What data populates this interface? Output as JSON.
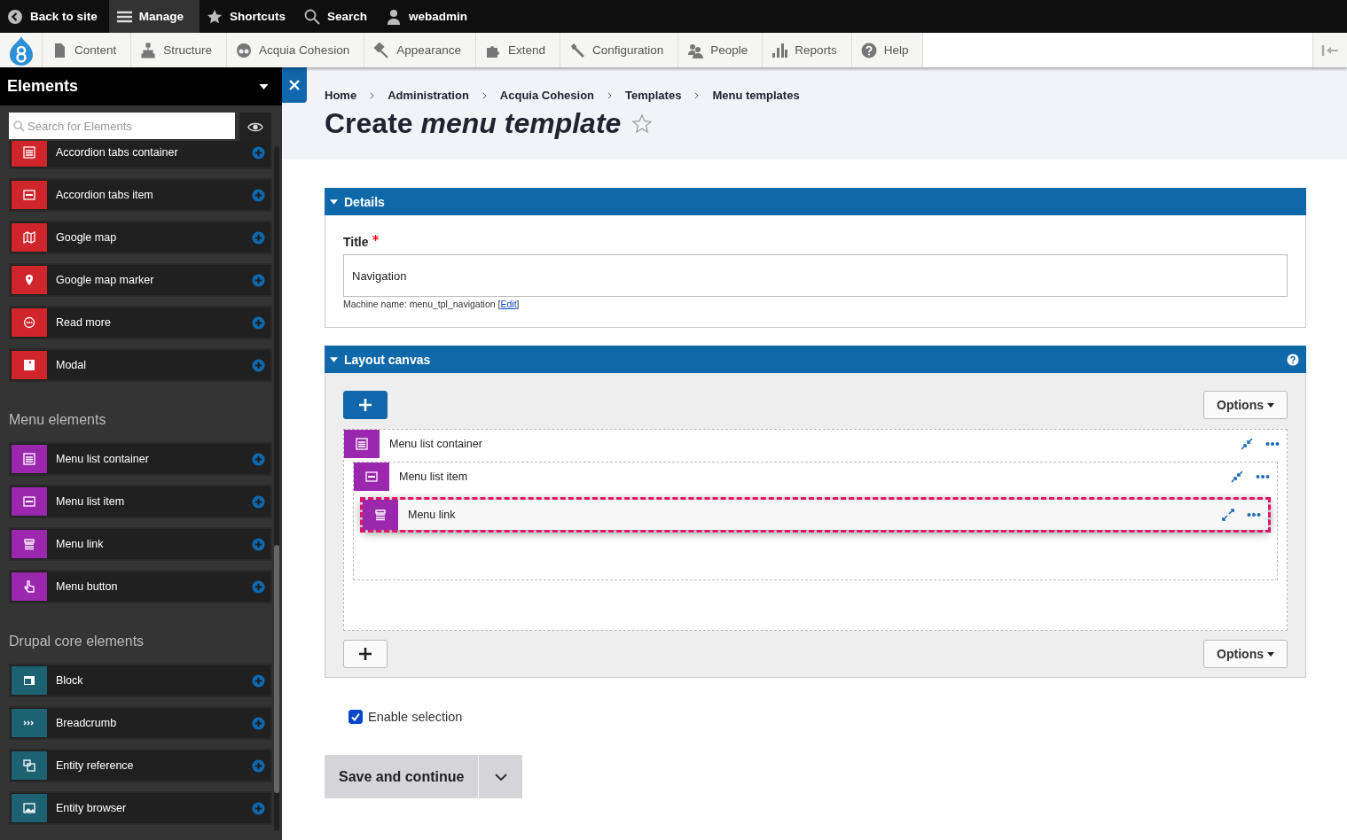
{
  "toolbar": {
    "items": [
      {
        "label": "Back to site",
        "kind": "back",
        "selected": false
      },
      {
        "label": "Manage",
        "kind": "manage",
        "selected": true
      },
      {
        "label": "Shortcuts",
        "kind": "star",
        "selected": false
      },
      {
        "label": "Search",
        "kind": "search",
        "selected": false
      },
      {
        "label": "webadmin",
        "kind": "user",
        "selected": false
      }
    ]
  },
  "admin_menu": {
    "items": [
      {
        "label": "Content",
        "kind": "doc"
      },
      {
        "label": "Structure",
        "kind": "tree"
      },
      {
        "label": "Acquia Cohesion",
        "kind": "cohesion"
      },
      {
        "label": "Appearance",
        "kind": "hammer"
      },
      {
        "label": "Extend",
        "kind": "puzzle"
      },
      {
        "label": "Configuration",
        "kind": "wrench"
      },
      {
        "label": "People",
        "kind": "people"
      },
      {
        "label": "Reports",
        "kind": "bars"
      },
      {
        "label": "Help",
        "kind": "help"
      }
    ]
  },
  "sidebar": {
    "title": "Elements",
    "search": {
      "placeholder": "Search for Elements"
    },
    "groups": [
      {
        "items": [
          {
            "label": "Accordion tabs container",
            "kind": "list",
            "color": "#d0262b"
          },
          {
            "label": "Accordion tabs item",
            "kind": "panel",
            "color": "#d0262b"
          },
          {
            "label": "Google map",
            "kind": "map",
            "color": "#d0262b"
          },
          {
            "label": "Google map marker",
            "kind": "pin",
            "color": "#d0262b"
          },
          {
            "label": "Read more",
            "kind": "dots",
            "color": "#d0262b"
          },
          {
            "label": "Modal",
            "kind": "modal",
            "color": "#d0262b"
          }
        ]
      },
      {
        "heading": "Menu elements",
        "items": [
          {
            "label": "Menu list container",
            "kind": "list",
            "color": "#9b27af"
          },
          {
            "label": "Menu list item",
            "kind": "panel",
            "color": "#9b27af"
          },
          {
            "label": "Menu link",
            "kind": "link",
            "color": "#9b27af"
          },
          {
            "label": "Menu button",
            "kind": "hand",
            "color": "#9b27af"
          }
        ]
      },
      {
        "heading": "Drupal core elements",
        "items": [
          {
            "label": "Block",
            "kind": "block",
            "color": "#1d6273"
          },
          {
            "label": "Breadcrumb",
            "kind": "crumbs",
            "color": "#1d6273"
          },
          {
            "label": "Entity reference",
            "kind": "reference",
            "color": "#1d6273"
          },
          {
            "label": "Entity browser",
            "kind": "image",
            "color": "#1d6273"
          }
        ]
      }
    ]
  },
  "breadcrumb": [
    "Home",
    "Administration",
    "Acquia Cohesion",
    "Templates",
    "Menu templates"
  ],
  "page_title": "Create *menu template*",
  "details": {
    "legend": "Details",
    "title_label": "Title",
    "required": true,
    "value": "Navigation",
    "machine_name": {
      "before": "Machine name: menu_tpl_navigation [",
      "link": "Edit",
      "after": "]"
    }
  },
  "layout_canvas": {
    "legend": "Layout canvas",
    "nodes": [
      {
        "label": "Menu list container",
        "kind": "list",
        "expanded": true,
        "selected": false,
        "children": [
          {
            "label": "Menu list item",
            "kind": "panel",
            "expanded": true,
            "selected": false,
            "children": [
              {
                "label": "Menu link",
                "kind": "link",
                "expanded": false,
                "selected": true
              }
            ]
          }
        ]
      }
    ],
    "options_label_top": "Options",
    "options_label_bottom": "Options"
  },
  "enable_selection": {
    "label": "Enable selection",
    "checked": true
  },
  "save_button": "Save and continue"
}
